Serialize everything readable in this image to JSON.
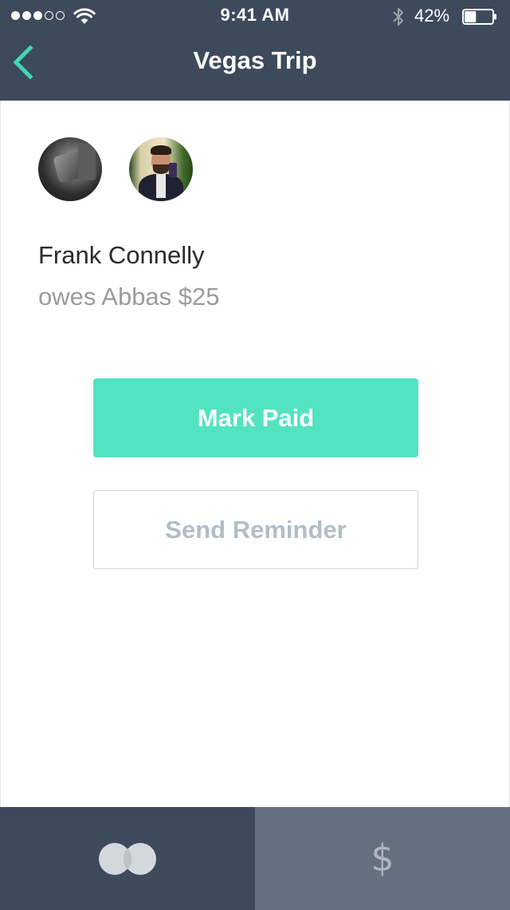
{
  "status_bar": {
    "time": "9:41 AM",
    "battery_percent": "42%",
    "battery_level": 0.42,
    "signal_bars_filled": 3,
    "signal_bars_total": 5
  },
  "nav": {
    "title": "Vegas Trip",
    "back_icon": "chevron-left-icon"
  },
  "debt": {
    "debtor_name": "Frank Connelly",
    "description": "owes Abbas $25"
  },
  "actions": {
    "mark_paid_label": "Mark Paid",
    "send_reminder_label": "Send Reminder"
  },
  "tabs": [
    {
      "icon": "overlapping-circles-icon",
      "active": true
    },
    {
      "icon": "dollar-sign-icon",
      "active": false,
      "glyph": "$"
    }
  ],
  "colors": {
    "header_bg": "#3d4a5b",
    "accent": "#52e3c0",
    "back_arrow": "#43d8b4",
    "secondary_text": "#9b9b9b",
    "reminder_text": "#b4bcc6",
    "tab_active_bg": "#3d4a5b",
    "tab_inactive_bg": "#65707f"
  }
}
